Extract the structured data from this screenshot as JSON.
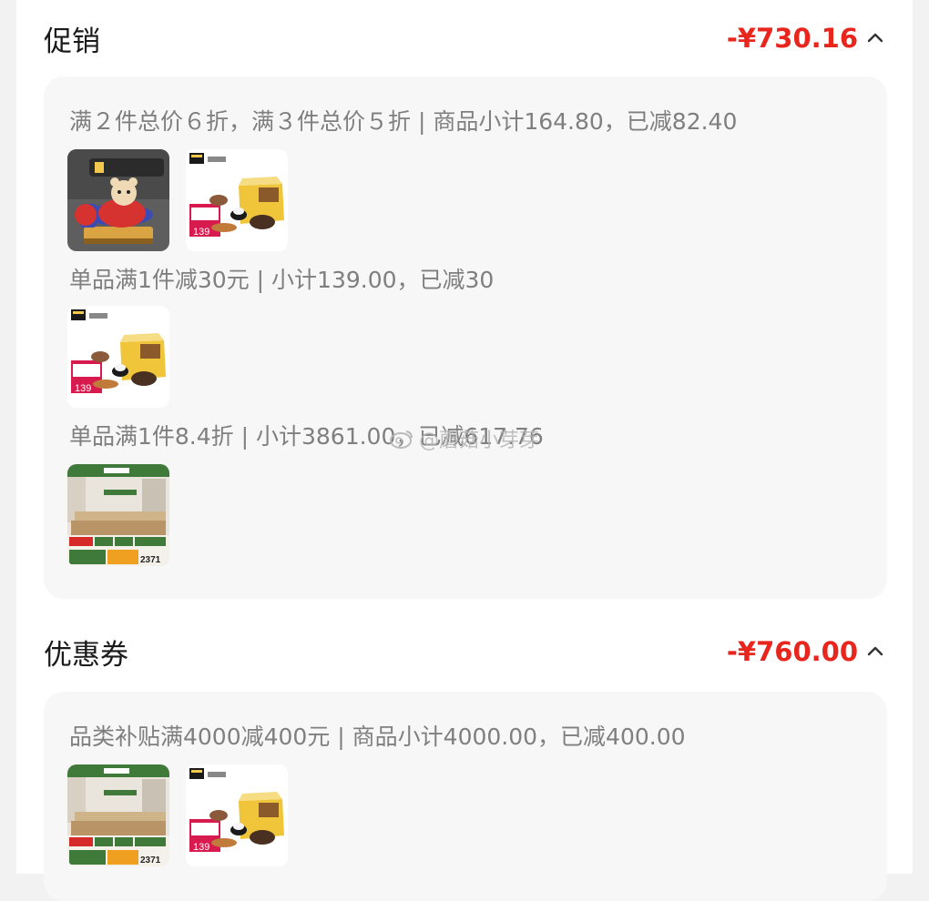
{
  "promotion": {
    "title": "促销",
    "amount": "-¥730.16",
    "groups": [
      {
        "rule": "满２件总价６折，满３件总价５折 | 商品小计164.80，已减82.40",
        "items": [
          "toy-airplane-thumb",
          "animal-figures-thumb"
        ]
      },
      {
        "rule": "单品满1件减30元 | 小计139.00，已减30",
        "items": [
          "animal-figures-thumb"
        ]
      },
      {
        "rule": "单品满1件8.4折 | 小计3861.00，已减617.76",
        "items": [
          "sofa-bed-thumb"
        ]
      }
    ]
  },
  "coupon": {
    "title": "优惠券",
    "amount": "-¥760.00",
    "groups": [
      {
        "rule": "品类补贴满4000减400元 | 商品小计4000.00，已减400.00",
        "items": [
          "sofa-bed-thumb",
          "animal-figures-thumb"
        ]
      }
    ]
  },
  "watermark": "@蘑菇小芽芽",
  "product_badges": {
    "price_tag": "139",
    "sofa_price": "2371"
  },
  "colors": {
    "accent_red": "#e8261e",
    "muted_text": "#7f7f7f",
    "box_bg": "#f7f7f7"
  }
}
